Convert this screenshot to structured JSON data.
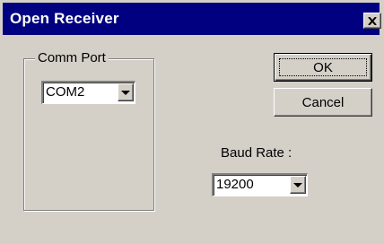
{
  "window": {
    "title": "Open Receiver",
    "close_icon": "close-icon"
  },
  "comm_port": {
    "group_label": "Comm Port",
    "selected": "COM2",
    "arrow_icon": "chevron-down-icon"
  },
  "buttons": {
    "ok_label": "OK",
    "cancel_label": "Cancel"
  },
  "baud_rate": {
    "label": "Baud Rate :",
    "selected": "19200",
    "arrow_icon": "chevron-down-icon"
  },
  "colors": {
    "title_bar": "#000080",
    "face": "#d4d0c8",
    "field": "#ffffff"
  }
}
